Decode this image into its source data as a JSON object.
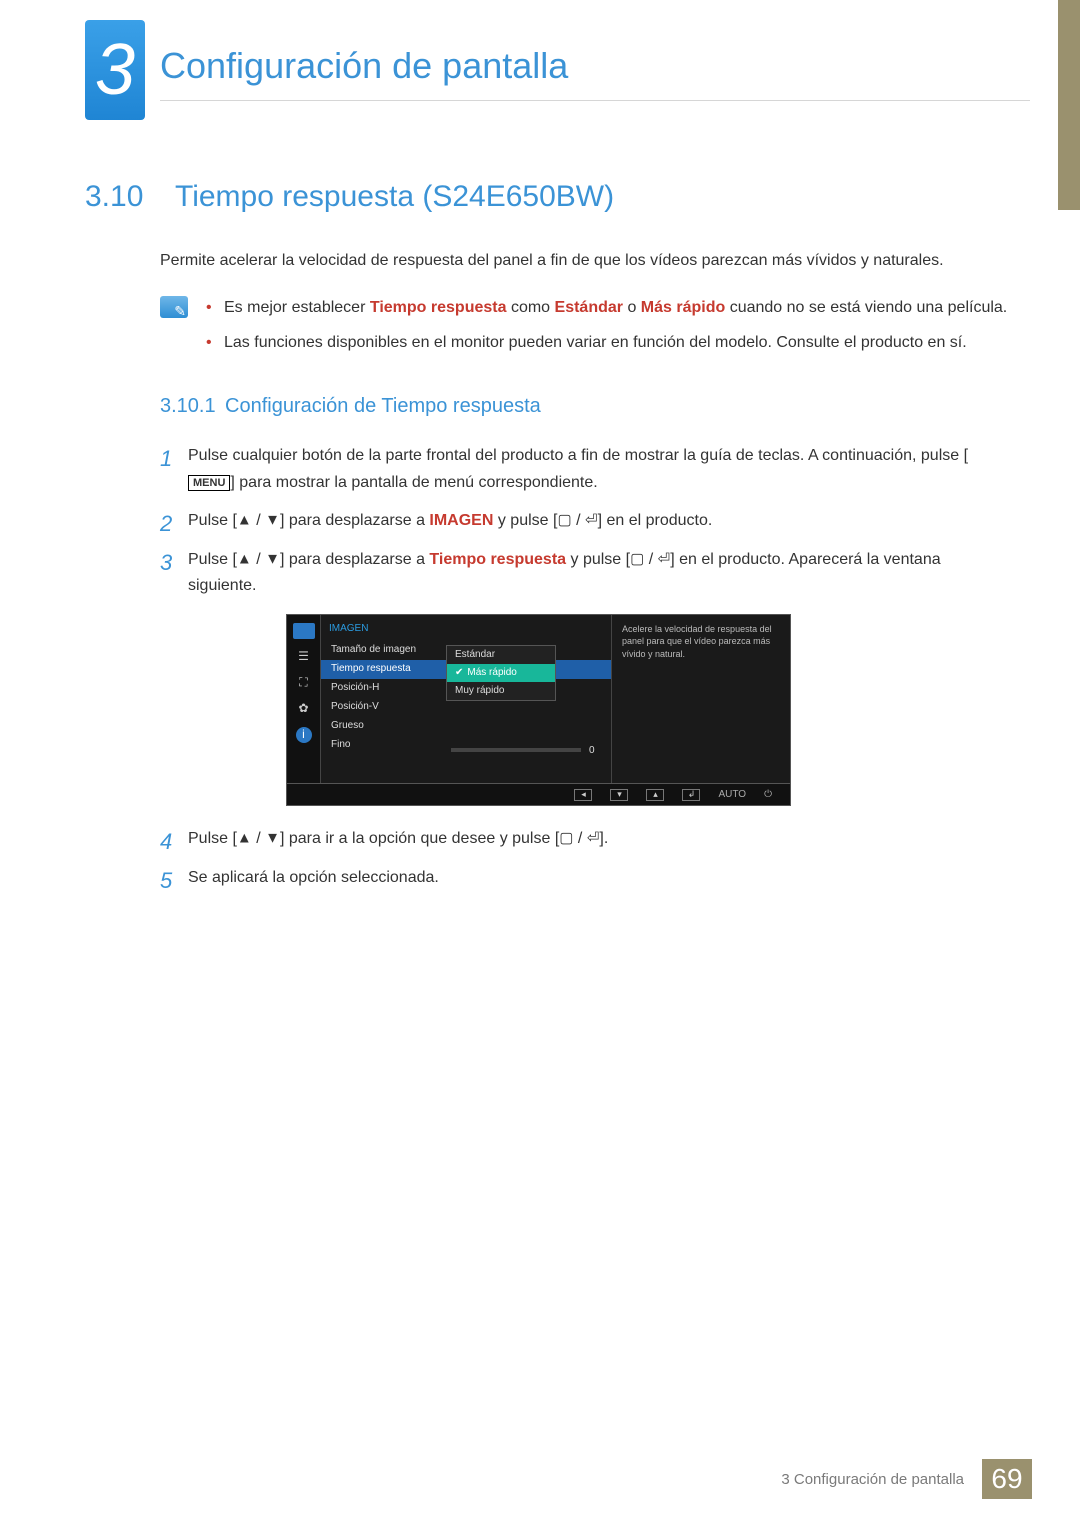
{
  "header": {
    "chapter_number": "3",
    "chapter_title": "Configuración de pantalla"
  },
  "section": {
    "number": "3.10",
    "title": "Tiempo respuesta (S24E650BW)",
    "intro": "Permite acelerar la velocidad de respuesta del panel a fin de que los vídeos parezcan más vívidos y naturales.",
    "notes": [
      {
        "pre": "Es mejor establecer ",
        "t1": "Tiempo respuesta",
        "mid1": " como ",
        "t2": "Estándar",
        "mid2": " o ",
        "t3": "Más rápido",
        "post": " cuando no se está viendo una película."
      },
      {
        "text": "Las funciones disponibles en el monitor pueden variar en función del modelo. Consulte el producto en sí."
      }
    ]
  },
  "subsection": {
    "number": "3.10.1",
    "title": "Configuración de Tiempo respuesta"
  },
  "keys": {
    "menu": "MENU"
  },
  "steps": [
    {
      "n": "1",
      "a": "Pulse cualquier botón de la parte frontal del producto a fin de mostrar la guía de teclas. A continuación, pulse",
      "b": " para mostrar la pantalla de menú correspondiente."
    },
    {
      "n": "2",
      "a": "Pulse ",
      "b": " para desplazarse a ",
      "term": "IMAGEN",
      "c": " y pulse ",
      "d": " en el producto."
    },
    {
      "n": "3",
      "a": "Pulse ",
      "b": " para desplazarse a ",
      "term": "Tiempo respuesta",
      "c": " y pulse ",
      "d": " en el producto. Aparecerá la ventana siguiente."
    },
    {
      "n": "4",
      "a": "Pulse ",
      "b": " para ir a la opción que desee y pulse ",
      "c": "."
    },
    {
      "n": "5",
      "a": "Se aplicará la opción seleccionada."
    }
  ],
  "osd": {
    "title": "IMAGEN",
    "items": [
      "Tamaño de imagen",
      "Tiempo respuesta",
      "Posición-H",
      "Posición-V",
      "Grueso",
      "Fino"
    ],
    "options": [
      "Estándar",
      "Más rápido",
      "Muy rápido"
    ],
    "slider_value": "0",
    "description": "Acelere la velocidad de respuesta del panel para que el vídeo parezca más vívido y natural.",
    "bottom": {
      "auto": "AUTO"
    }
  },
  "footer": {
    "label": "3  Configuración de pantalla",
    "page": "69"
  }
}
